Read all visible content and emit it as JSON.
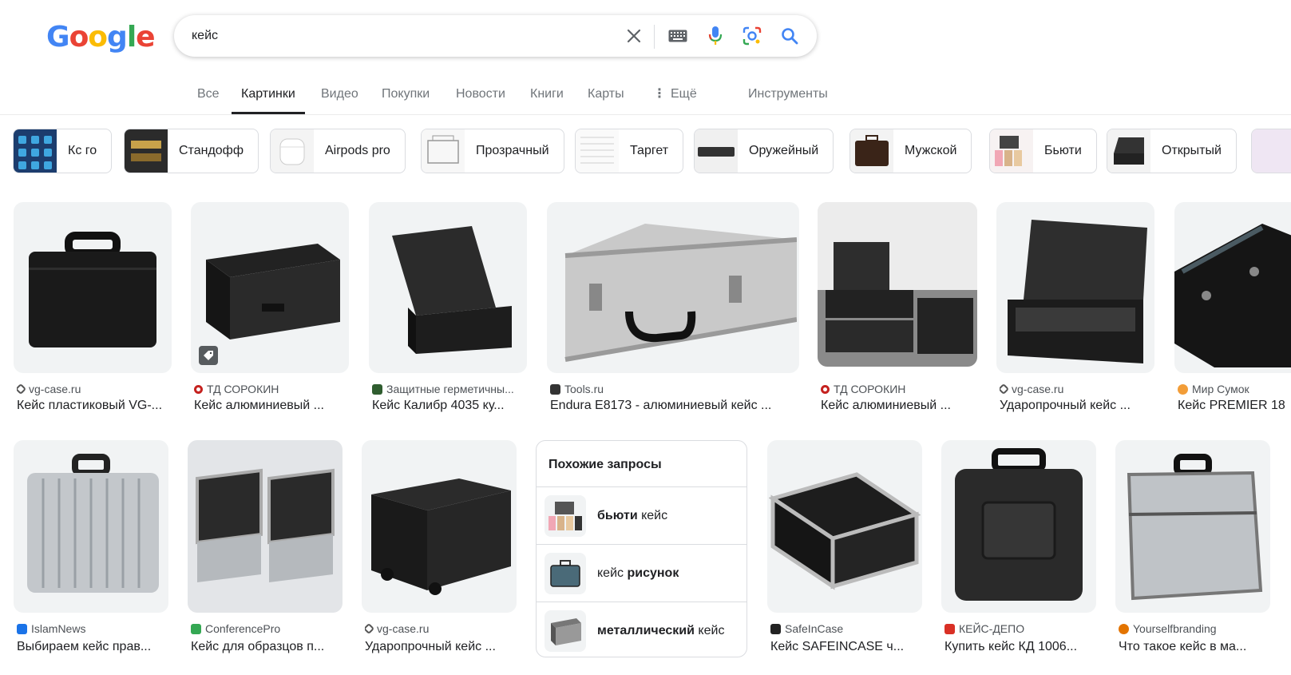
{
  "logo": {
    "letters": [
      "G",
      "o",
      "o",
      "g",
      "l",
      "e"
    ],
    "colors": [
      "#4285F4",
      "#EA4335",
      "#FBBC05",
      "#4285F4",
      "#34A853",
      "#EA4335"
    ]
  },
  "search": {
    "query": "кейс",
    "icons": [
      "close-icon",
      "keyboard-icon",
      "microphone-icon",
      "lens-icon",
      "search-icon"
    ]
  },
  "tabs": {
    "all": "Все",
    "images": "Картинки",
    "video": "Видео",
    "shopping": "Покупки",
    "news": "Новости",
    "books": "Книги",
    "maps": "Карты",
    "more": "Ещё",
    "tools": "Инструменты"
  },
  "chips": [
    {
      "label": "Кс го"
    },
    {
      "label": "Стандофф"
    },
    {
      "label": "Airpods pro"
    },
    {
      "label": "Прозрачный"
    },
    {
      "label": "Таргет"
    },
    {
      "label": "Оружейный"
    },
    {
      "label": "Мужской"
    },
    {
      "label": "Бьюти"
    },
    {
      "label": "Открытый"
    }
  ],
  "results_row1": [
    {
      "source": "vg-case.ru",
      "title": "Кейс пластиковый VG-..."
    },
    {
      "source": "ТД СОРОКИН",
      "title": "Кейс алюминиевый ..."
    },
    {
      "source": "Защитные герметичны...",
      "title": "Кейс Калибр 4035 ку..."
    },
    {
      "source": "Tools.ru",
      "title": "Endura E8173 - алюминиевый кейс ..."
    },
    {
      "source": "ТД СОРОКИН",
      "title": "Кейс алюминиевый ..."
    },
    {
      "source": "vg-case.ru",
      "title": "Ударопрочный кейс ..."
    },
    {
      "source": "Мир Сумок",
      "title": "Кейс PREMIER 18"
    }
  ],
  "results_row2": [
    {
      "source": "IslamNews",
      "title": "Выбираем кейс прав..."
    },
    {
      "source": "ConferencePro",
      "title": "Кейс для образцов п..."
    },
    {
      "source": "vg-case.ru",
      "title": "Ударопрочный кейс ..."
    },
    {
      "source": "SafeInCase",
      "title": "Кейс SAFEINCASE ч..."
    },
    {
      "source": "КЕЙС-ДЕПО",
      "title": "Купить кейс КД 1006..."
    },
    {
      "source": "Yourselfbranding",
      "title": "Что такое кейс в ма..."
    }
  ],
  "related": {
    "title": "Похожие запросы",
    "items": [
      {
        "bold": "бьюти",
        "rest": " кейс"
      },
      {
        "rest": "кейс ",
        "bold": "рисунок"
      },
      {
        "bold": "металлический",
        "rest": " кейс"
      }
    ]
  }
}
